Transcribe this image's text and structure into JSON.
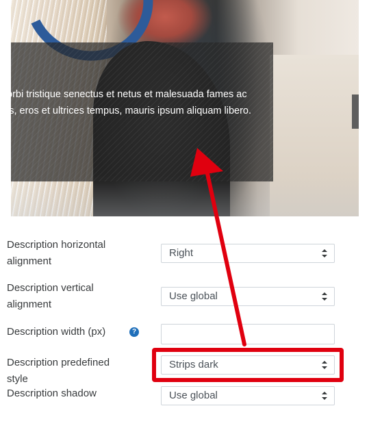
{
  "preview": {
    "caption_line1": "orbi tristique senectus et netus et malesuada fames ac",
    "caption_line2": "is, eros et ultrices tempus, mauris ipsum aliquam libero."
  },
  "form": {
    "horizontal_alignment": {
      "label_line1": "Description horizontal",
      "label_line2": "alignment",
      "value": "Right"
    },
    "vertical_alignment": {
      "label_line1": "Description vertical",
      "label_line2": "alignment",
      "value": "Use global"
    },
    "width": {
      "label": "Description width (px)",
      "help_icon": "question-circle-icon",
      "value": ""
    },
    "predefined_style": {
      "label": "Description predefined style",
      "value": "Strips dark"
    },
    "shadow": {
      "label": "Description shadow",
      "value": "Use global"
    }
  },
  "annotation": {
    "color": "#e0000f"
  }
}
